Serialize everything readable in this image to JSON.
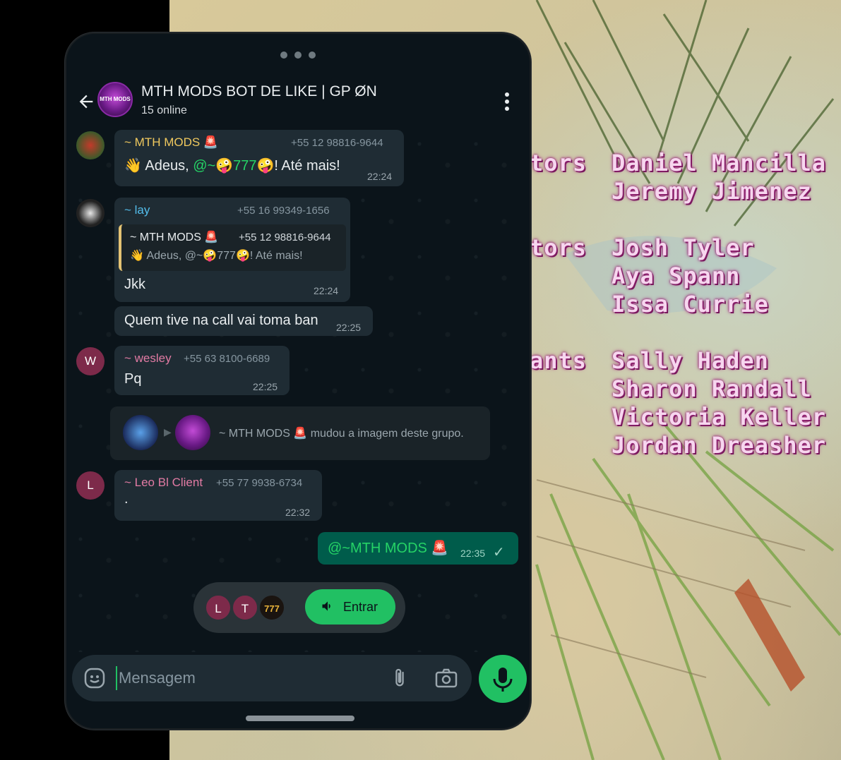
{
  "header": {
    "title": "MTH MODS BOT DE LIKE | GP ØN",
    "subtitle": "15 online",
    "avatar_text": "MTH MODS"
  },
  "background_credits": [
    {
      "role": "tors",
      "names": [
        "Daniel Mancilla",
        "Jeremy Jimenez"
      ]
    },
    {
      "role": "tors",
      "names": [
        "Josh Tyler",
        "Aya Spann",
        "Issa Currie"
      ]
    },
    {
      "role": "ants",
      "names": [
        "Sally Haden",
        "Sharon Randall",
        "Victoria Keller",
        "Jordan Dreasher"
      ]
    }
  ],
  "messages": [
    {
      "sender": "~ MTH MODS 🚨",
      "phone": "+55 12 98816-9644",
      "text_prefix": "👋 Adeus, ",
      "mention": "@~🤪777",
      "text_suffix": "🤪! Até mais!",
      "time": "22:24"
    },
    {
      "sender": "~ lay",
      "phone": "+55 16 99349-1656",
      "quote": {
        "sender": "~ MTH MODS 🚨",
        "phone": "+55 12 98816-9644",
        "text": "👋 Adeus, @~🤪777🤪! Até mais!"
      },
      "text": "Jkk",
      "time": "22:24"
    },
    {
      "text": "Quem tive na call vai toma ban",
      "time": "22:25"
    },
    {
      "sender": "~ wesley",
      "phone": "+55 63 8100-6689",
      "text": "Pq",
      "time": "22:25",
      "avatar_letter": "W"
    },
    {
      "sender": "~ Leo Bl Client",
      "phone": "+55 77 9938-6734",
      "text": ".",
      "time": "22:32",
      "avatar_letter": "L"
    }
  ],
  "system_event": {
    "actor": "~ MTH MODS 🚨",
    "action": "mudou a imagem deste grupo."
  },
  "outgoing": {
    "text": "@~MTH MODS 🚨",
    "time": "22:35",
    "status": "✓"
  },
  "voice_chat": {
    "participants": [
      "L",
      "T",
      "777"
    ],
    "join_label": "Entrar"
  },
  "composer": {
    "placeholder": "Mensagem"
  },
  "colors": {
    "accent": "#21c063",
    "mention": "#25d366",
    "sender_mth": "#f0c95e",
    "sender_lay": "#53bdeb",
    "sender_wesley": "#e27ba4",
    "sender_leo": "#e27ba4"
  }
}
